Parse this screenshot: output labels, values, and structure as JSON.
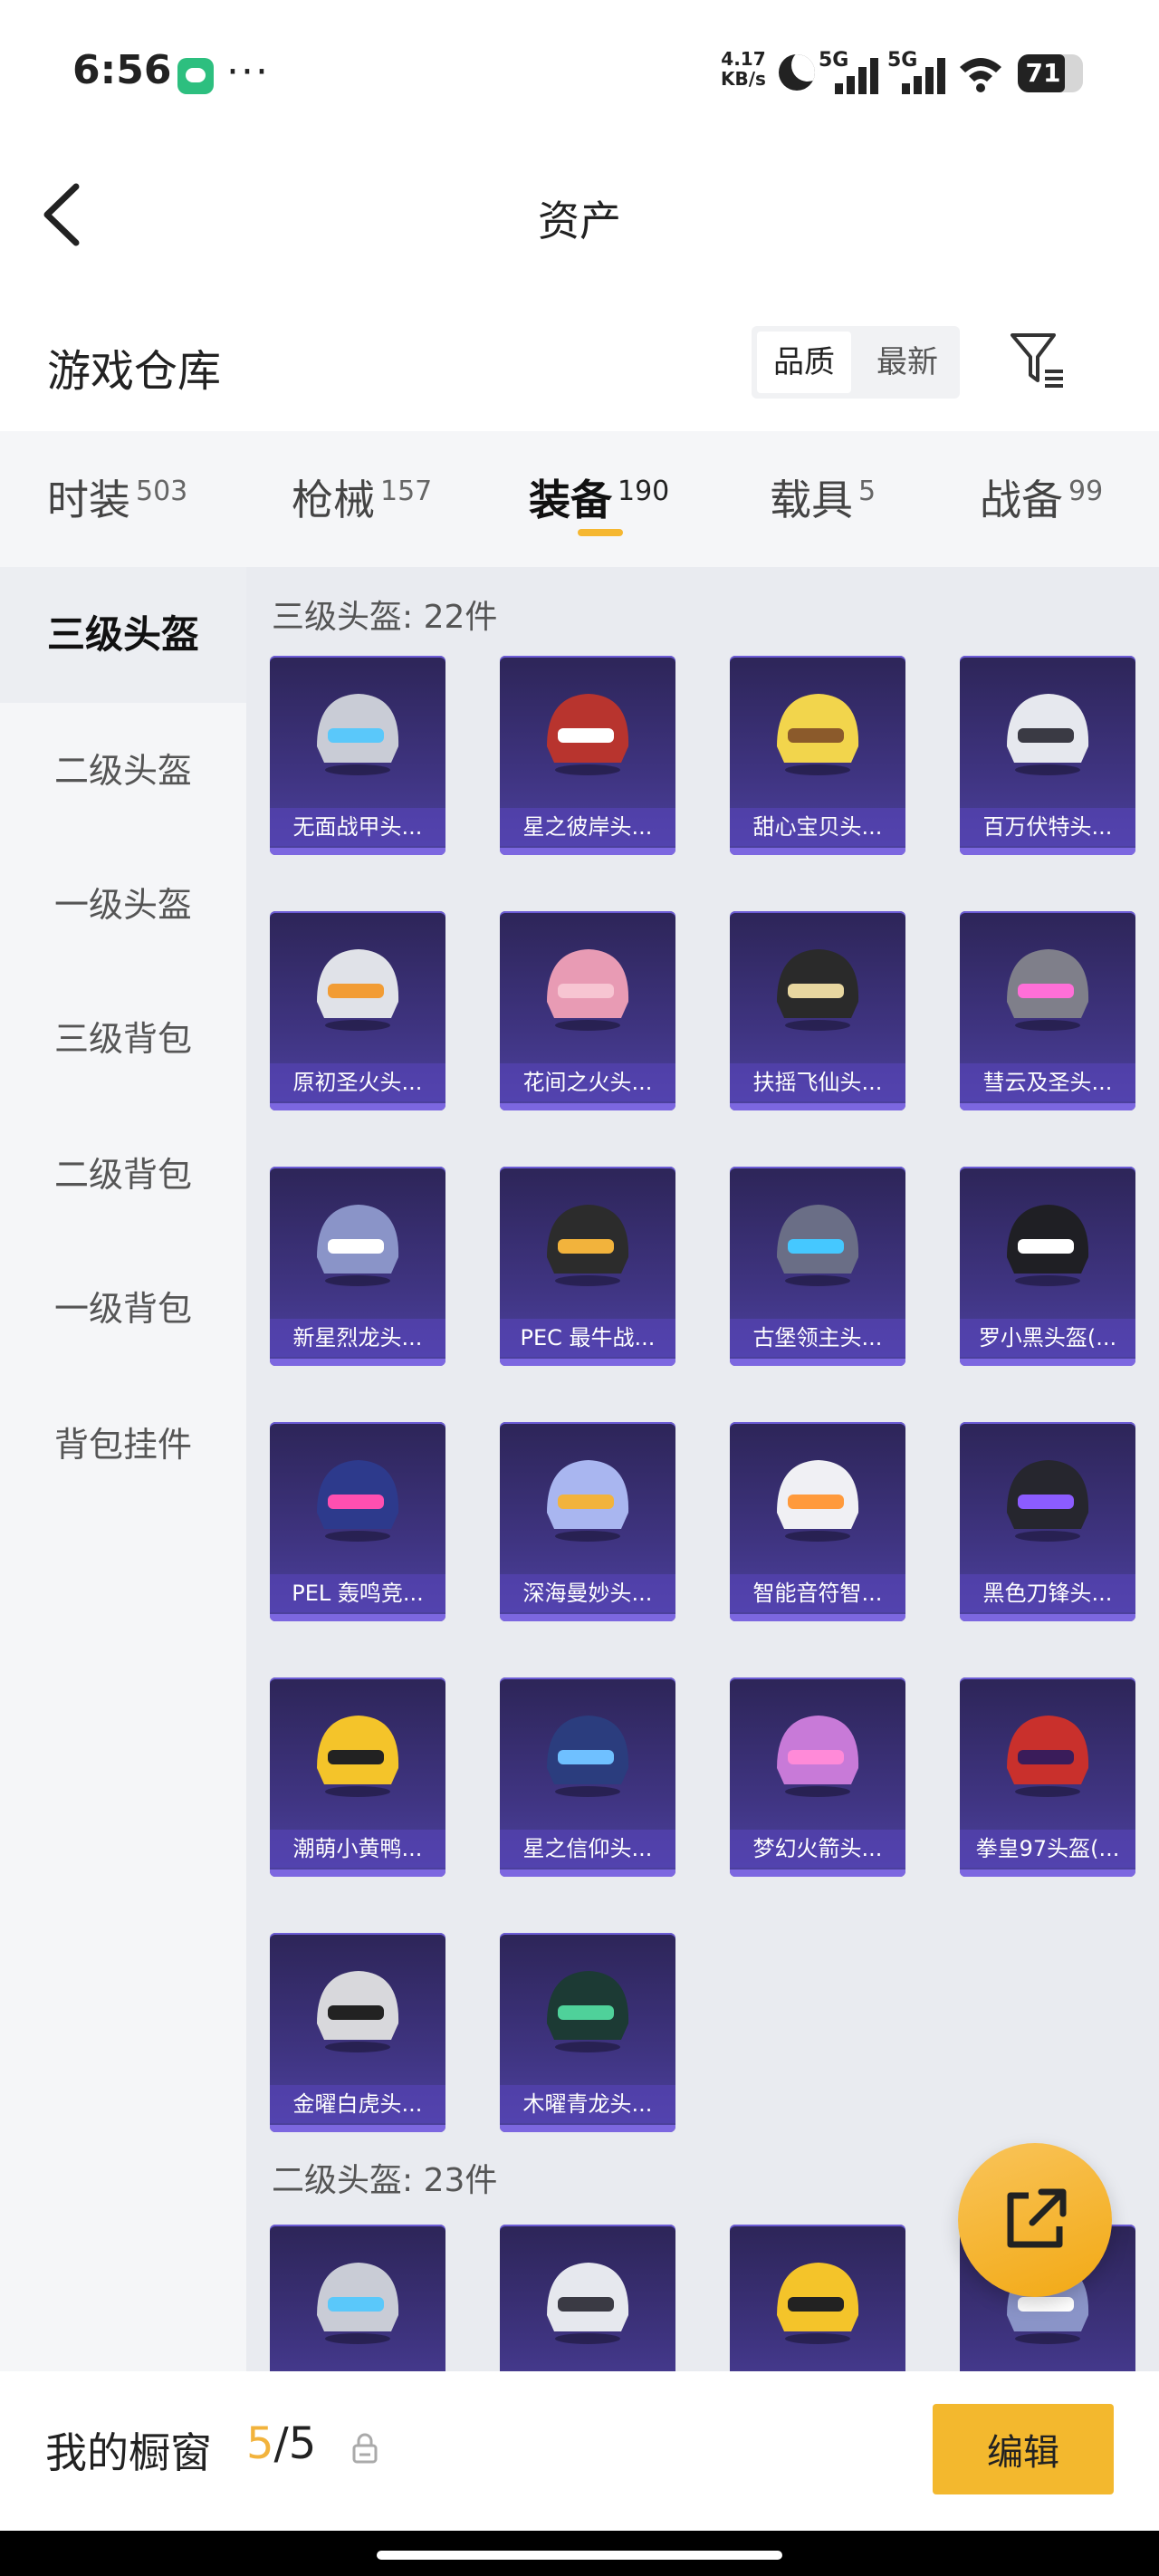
{
  "status_bar": {
    "time": "6:56",
    "dots": "···",
    "net_speed_value": "4.17",
    "net_speed_unit": "KB/s",
    "sim1": "5G",
    "sim2": "5G",
    "battery": "71",
    "icons": [
      "wechat-icon",
      "moon-icon",
      "signal-icon",
      "wifi-icon",
      "battery-icon"
    ]
  },
  "header": {
    "title": "资产"
  },
  "warehouse": {
    "title": "游戏仓库",
    "sort_quality": "品质",
    "sort_newest": "最新",
    "active_sort": "品质"
  },
  "tabs": [
    {
      "label": "时装",
      "count": "503"
    },
    {
      "label": "枪械",
      "count": "157"
    },
    {
      "label": "装备",
      "count": "190"
    },
    {
      "label": "载具",
      "count": "5"
    },
    {
      "label": "战备",
      "count": "99"
    }
  ],
  "active_tab": "装备",
  "sidebar": {
    "items": [
      "三级头盔",
      "二级头盔",
      "一级头盔",
      "三级背包",
      "二级背包",
      "一级背包",
      "背包挂件"
    ],
    "active": "三级头盔"
  },
  "groups": [
    {
      "title": "三级头盔: 22件",
      "items": [
        "无面战甲头...",
        "星之彼岸头...",
        "甜心宝贝头...",
        "百万伏特头...",
        "原初圣火头...",
        "花间之火头...",
        "扶摇飞仙头...",
        "彗云及圣头...",
        "新星烈龙头...",
        "PEC 最牛战...",
        "古堡领主头...",
        "罗小黑头盔(...",
        "PEL 轰鸣竞...",
        "深海曼妙头...",
        "智能音符智...",
        "黑色刀锋头...",
        "潮萌小黄鸭...",
        "星之信仰头...",
        "梦幻火箭头...",
        "拳皇97头盔(...",
        "金曜白虎头...",
        "木曜青龙头..."
      ]
    },
    {
      "title": "二级头盔: 23件",
      "items": []
    }
  ],
  "bottom": {
    "label": "我的橱窗",
    "current": "5",
    "separator": "/",
    "total": "5",
    "edit": "编辑"
  },
  "colors": {
    "accent": "#f3b82e",
    "card_bg": "#3f3481",
    "card_border": "#7c67e0"
  }
}
